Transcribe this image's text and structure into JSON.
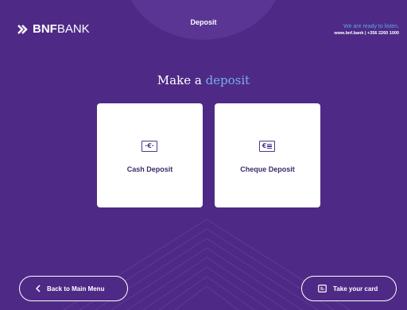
{
  "brand": {
    "bold": "BNF",
    "light": "BANK",
    "logo_icon": "bnf-chevron-icon"
  },
  "header": {
    "title": "Deposit"
  },
  "contact": {
    "tagline": "We are ready to listen.",
    "details": "www.bnf.bank | +356 2260 1000"
  },
  "main": {
    "heading_prefix": "Make a",
    "heading_accent": "deposit",
    "options": [
      {
        "label": "Cash Deposit",
        "icon": "cash-euro-icon"
      },
      {
        "label": "Cheque Deposit",
        "icon": "cheque-euro-icon"
      }
    ]
  },
  "footer": {
    "back_label": "Back to Main Menu",
    "back_icon": "chevron-left-icon",
    "card_label": "Take your card",
    "card_icon": "card-eject-icon"
  },
  "colors": {
    "background": "#4e2a86",
    "accent": "#7aaee8",
    "card": "#ffffff",
    "card_text": "#3d2a6a"
  }
}
